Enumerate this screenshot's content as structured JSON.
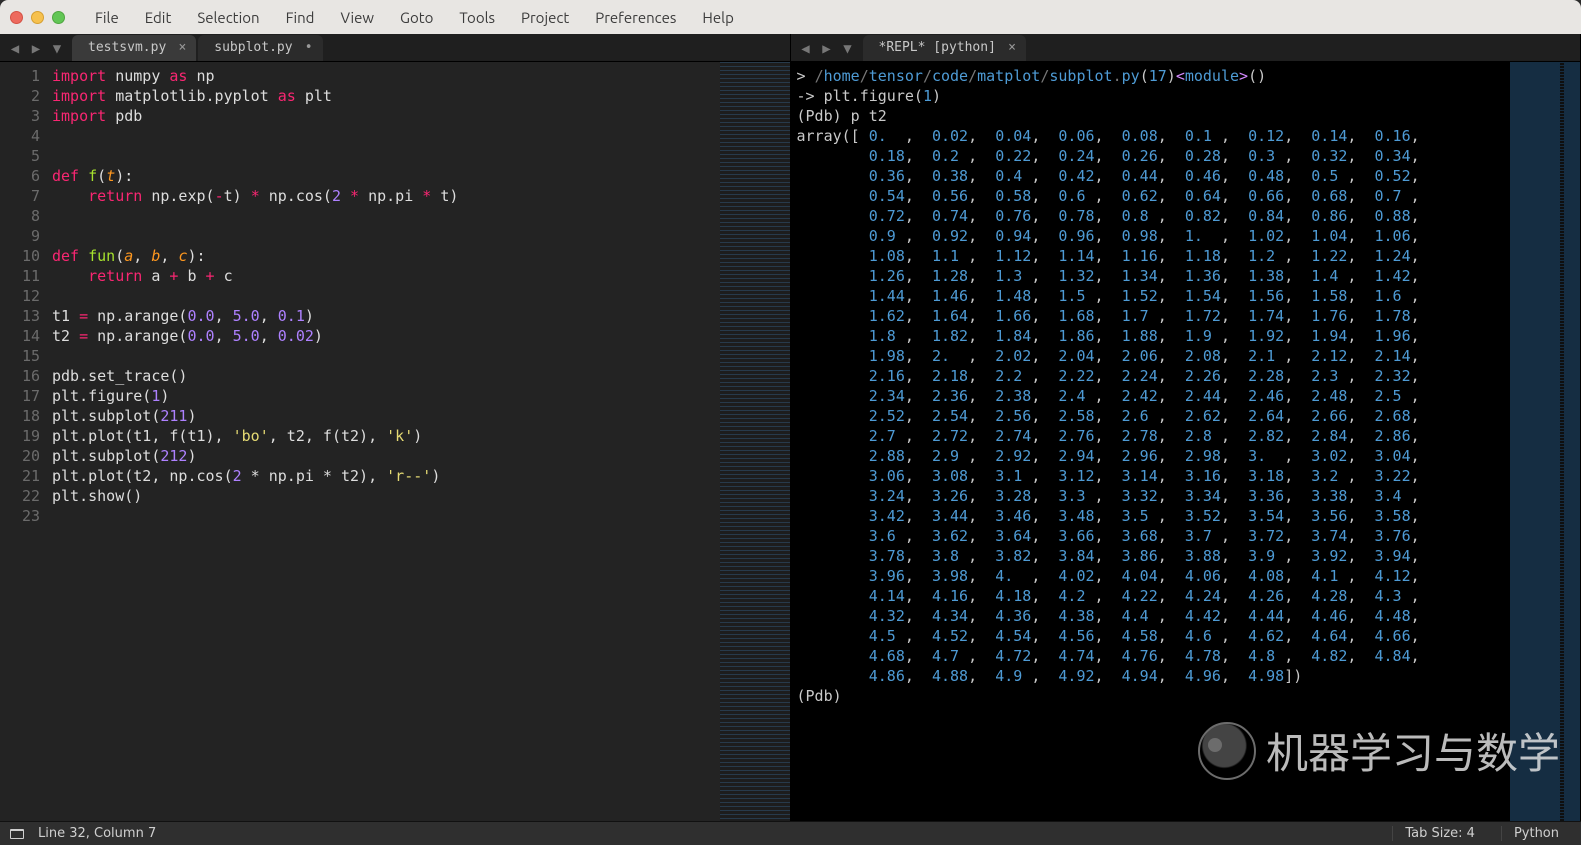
{
  "menubar": {
    "items": [
      "File",
      "Edit",
      "Selection",
      "Find",
      "View",
      "Goto",
      "Tools",
      "Project",
      "Preferences",
      "Help"
    ]
  },
  "left": {
    "tabs": [
      {
        "label": "testsvm.py",
        "mark": "×",
        "active": false
      },
      {
        "label": "subplot.py",
        "mark": "•",
        "active": true
      }
    ],
    "lines": 23,
    "code": {
      "l1a": "import",
      "l1b": " numpy ",
      "l1c": "as",
      "l1d": " np",
      "l2a": "import",
      "l2b": " matplotlib.pyplot ",
      "l2c": "as",
      "l2d": " plt",
      "l3a": "import",
      "l3b": " pdb",
      "l6a": "def ",
      "l6b": "f",
      "l6c": "(",
      "l6d": "t",
      "l6e": "):",
      "l7a": "    ",
      "l7b": "return",
      "l7c": " np.exp(",
      "l7d": "-",
      "l7e": "t) ",
      "l7f": "*",
      "l7g": " np.cos(",
      "l7h": "2",
      "l7i": " * ",
      "l7j": "np.pi ",
      "l7k": "*",
      "l7l": " t)",
      "l10a": "def ",
      "l10b": "fun",
      "l10c": "(",
      "l10d": "a",
      "l10e": ", ",
      "l10f": "b",
      "l10g": ", ",
      "l10h": "c",
      "l10i": "):",
      "l11a": "    ",
      "l11b": "return",
      "l11c": " a ",
      "l11d": "+",
      "l11e": " b ",
      "l11f": "+",
      "l11g": " c",
      "l13a": "t1 ",
      "l13b": "=",
      "l13c": " np.arange(",
      "l13v1": "0.0",
      "l13s1": ", ",
      "l13v2": "5.0",
      "l13s2": ", ",
      "l13v3": "0.1",
      "l13e": ")",
      "l14a": "t2 ",
      "l14b": "=",
      "l14c": " np.arange(",
      "l14v1": "0.0",
      "l14s1": ", ",
      "l14v2": "5.0",
      "l14s2": ", ",
      "l14v3": "0.02",
      "l14e": ")",
      "l16": "pdb.set_trace()",
      "l17a": "plt.figure(",
      "l17v": "1",
      "l17e": ")",
      "l18a": "plt.subplot(",
      "l18v": "211",
      "l18e": ")",
      "l19a": "plt.plot(t1, f(t1), ",
      "l19s1": "'bo'",
      "l19b": ", t2, f(t2), ",
      "l19s2": "'k'",
      "l19e": ")",
      "l20a": "plt.subplot(",
      "l20v": "212",
      "l20e": ")",
      "l21a": "plt.plot(t2, np.cos(",
      "l21v1": "2",
      "l21b": " * np.pi * t2), ",
      "l21s": "'r--'",
      "l21e": ")",
      "l22": "plt.show()"
    }
  },
  "right": {
    "tabs": [
      {
        "label": "*REPL* [python]",
        "mark": "×",
        "active": true
      }
    ],
    "prompt1": {
      "gt": "> ",
      "p1": "/",
      "p2": "home",
      "p3": "/",
      "p4": "tensor",
      "p5": "/",
      "p6": "code",
      "p7": "/",
      "p8": "matplot",
      "p9": "/",
      "p10": "subplot",
      "p11": ".",
      "p12": "py",
      "p13": "(",
      "p14": "17",
      "p15": ")",
      "p16": "<",
      "p17": "module",
      "p18": ">",
      "p19": "()"
    },
    "line2": {
      "a": "-> plt.figure(",
      "b": "1",
      "c": ")"
    },
    "line3": "(Pdb) p t2",
    "arrayHead": "array([ ",
    "pdbEnd": "(Pdb)",
    "arrayValues": [
      "0.  ",
      "0.02",
      "0.04",
      "0.06",
      "0.08",
      "0.1 ",
      "0.12",
      "0.14",
      "0.16",
      "0.18",
      "0.2 ",
      "0.22",
      "0.24",
      "0.26",
      "0.28",
      "0.3 ",
      "0.32",
      "0.34",
      "0.36",
      "0.38",
      "0.4 ",
      "0.42",
      "0.44",
      "0.46",
      "0.48",
      "0.5 ",
      "0.52",
      "0.54",
      "0.56",
      "0.58",
      "0.6 ",
      "0.62",
      "0.64",
      "0.66",
      "0.68",
      "0.7 ",
      "0.72",
      "0.74",
      "0.76",
      "0.78",
      "0.8 ",
      "0.82",
      "0.84",
      "0.86",
      "0.88",
      "0.9 ",
      "0.92",
      "0.94",
      "0.96",
      "0.98",
      "1.  ",
      "1.02",
      "1.04",
      "1.06",
      "1.08",
      "1.1 ",
      "1.12",
      "1.14",
      "1.16",
      "1.18",
      "1.2 ",
      "1.22",
      "1.24",
      "1.26",
      "1.28",
      "1.3 ",
      "1.32",
      "1.34",
      "1.36",
      "1.38",
      "1.4 ",
      "1.42",
      "1.44",
      "1.46",
      "1.48",
      "1.5 ",
      "1.52",
      "1.54",
      "1.56",
      "1.58",
      "1.6 ",
      "1.62",
      "1.64",
      "1.66",
      "1.68",
      "1.7 ",
      "1.72",
      "1.74",
      "1.76",
      "1.78",
      "1.8 ",
      "1.82",
      "1.84",
      "1.86",
      "1.88",
      "1.9 ",
      "1.92",
      "1.94",
      "1.96",
      "1.98",
      "2.  ",
      "2.02",
      "2.04",
      "2.06",
      "2.08",
      "2.1 ",
      "2.12",
      "2.14",
      "2.16",
      "2.18",
      "2.2 ",
      "2.22",
      "2.24",
      "2.26",
      "2.28",
      "2.3 ",
      "2.32",
      "2.34",
      "2.36",
      "2.38",
      "2.4 ",
      "2.42",
      "2.44",
      "2.46",
      "2.48",
      "2.5 ",
      "2.52",
      "2.54",
      "2.56",
      "2.58",
      "2.6 ",
      "2.62",
      "2.64",
      "2.66",
      "2.68",
      "2.7 ",
      "2.72",
      "2.74",
      "2.76",
      "2.78",
      "2.8 ",
      "2.82",
      "2.84",
      "2.86",
      "2.88",
      "2.9 ",
      "2.92",
      "2.94",
      "2.96",
      "2.98",
      "3.  ",
      "3.02",
      "3.04",
      "3.06",
      "3.08",
      "3.1 ",
      "3.12",
      "3.14",
      "3.16",
      "3.18",
      "3.2 ",
      "3.22",
      "3.24",
      "3.26",
      "3.28",
      "3.3 ",
      "3.32",
      "3.34",
      "3.36",
      "3.38",
      "3.4 ",
      "3.42",
      "3.44",
      "3.46",
      "3.48",
      "3.5 ",
      "3.52",
      "3.54",
      "3.56",
      "3.58",
      "3.6 ",
      "3.62",
      "3.64",
      "3.66",
      "3.68",
      "3.7 ",
      "3.72",
      "3.74",
      "3.76",
      "3.78",
      "3.8 ",
      "3.82",
      "3.84",
      "3.86",
      "3.88",
      "3.9 ",
      "3.92",
      "3.94",
      "3.96",
      "3.98",
      "4.  ",
      "4.02",
      "4.04",
      "4.06",
      "4.08",
      "4.1 ",
      "4.12",
      "4.14",
      "4.16",
      "4.18",
      "4.2 ",
      "4.22",
      "4.24",
      "4.26",
      "4.28",
      "4.3 ",
      "4.32",
      "4.34",
      "4.36",
      "4.38",
      "4.4 ",
      "4.42",
      "4.44",
      "4.46",
      "4.48",
      "4.5 ",
      "4.52",
      "4.54",
      "4.56",
      "4.58",
      "4.6 ",
      "4.62",
      "4.64",
      "4.66",
      "4.68",
      "4.7 ",
      "4.72",
      "4.74",
      "4.76",
      "4.78",
      "4.8 ",
      "4.82",
      "4.84",
      "4.86",
      "4.88",
      "4.9 ",
      "4.92",
      "4.94",
      "4.96",
      "4.98"
    ]
  },
  "statusbar": {
    "pos": "Line 32, Column 7",
    "tab": "Tab Size: 4",
    "lang": "Python"
  },
  "watermark": "机器学习与数学"
}
